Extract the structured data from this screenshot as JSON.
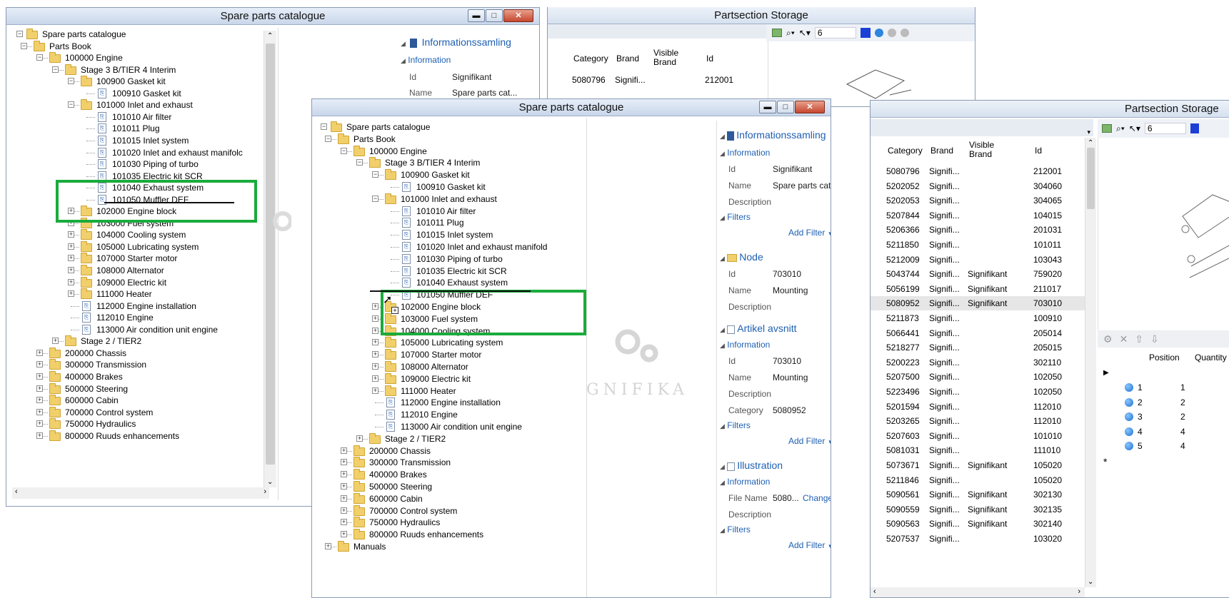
{
  "back_window": {
    "title": "Spare parts catalogue",
    "tree": [
      {
        "label": "Spare parts catalogue",
        "level": 0,
        "kind": "root"
      },
      {
        "label": "Parts Book",
        "level": 1,
        "kind": "folder"
      },
      {
        "label": "100000 Engine",
        "level": 2,
        "kind": "folder"
      },
      {
        "label": "Stage 3 B/TIER 4 Interim",
        "level": 3,
        "kind": "folder"
      },
      {
        "label": "100900 Gasket kit",
        "level": 4,
        "kind": "folder"
      },
      {
        "label": "100910 Gasket kit",
        "level": 5,
        "kind": "doc"
      },
      {
        "label": "101000 Inlet and exhaust",
        "level": 4,
        "kind": "folder"
      },
      {
        "label": "101010 Air filter",
        "level": 5,
        "kind": "doc"
      },
      {
        "label": "101011 Plug",
        "level": 5,
        "kind": "doc"
      },
      {
        "label": "101015 Inlet system",
        "level": 5,
        "kind": "doc"
      },
      {
        "label": "101020 Inlet and exhaust manifolc",
        "level": 5,
        "kind": "doc"
      },
      {
        "label": "101030 Piping of turbo",
        "level": 5,
        "kind": "doc"
      },
      {
        "label": "101035 Electric kit SCR",
        "level": 5,
        "kind": "doc"
      },
      {
        "label": "101040 Exhaust system",
        "level": 5,
        "kind": "doc"
      },
      {
        "label": "101050 Muffler DEF",
        "level": 5,
        "kind": "doc"
      },
      {
        "label": "102000 Engine block",
        "level": 4,
        "kind": "folder"
      },
      {
        "label": "103000 Fuel system",
        "level": 4,
        "kind": "folder"
      },
      {
        "label": "104000 Cooling system",
        "level": 4,
        "kind": "folder"
      },
      {
        "label": "105000 Lubricating system",
        "level": 4,
        "kind": "folder"
      },
      {
        "label": "107000 Starter motor",
        "level": 4,
        "kind": "folder"
      },
      {
        "label": "108000 Alternator",
        "level": 4,
        "kind": "folder"
      },
      {
        "label": "109000 Electric kit",
        "level": 4,
        "kind": "folder"
      },
      {
        "label": "111000 Heater",
        "level": 4,
        "kind": "folder"
      },
      {
        "label": "112000 Engine installation",
        "level": 4,
        "kind": "doc"
      },
      {
        "label": "112010 Engine",
        "level": 4,
        "kind": "doc"
      },
      {
        "label": "113000 Air condition unit engine",
        "level": 4,
        "kind": "doc"
      },
      {
        "label": "Stage 2 / TIER2",
        "level": 3,
        "kind": "folder"
      },
      {
        "label": "200000 Chassis",
        "level": 2,
        "kind": "folder"
      },
      {
        "label": "300000 Transmission",
        "level": 2,
        "kind": "folder"
      },
      {
        "label": "400000 Brakes",
        "level": 2,
        "kind": "folder"
      },
      {
        "label": "500000 Steering",
        "level": 2,
        "kind": "folder"
      },
      {
        "label": "600000 Cabin",
        "level": 2,
        "kind": "folder"
      },
      {
        "label": "700000 Control system",
        "level": 2,
        "kind": "folder"
      },
      {
        "label": "750000 Hydraulics",
        "level": 2,
        "kind": "folder"
      },
      {
        "label": "800000 Ruuds enhancements",
        "level": 2,
        "kind": "folder"
      }
    ],
    "panel": {
      "section": "Informationssamling",
      "sub": "Information",
      "rows": [
        {
          "k": "Id",
          "v": "Signifikant"
        },
        {
          "k": "Name",
          "v": "Spare parts cat..."
        }
      ]
    }
  },
  "back_storage": {
    "title": "Partsection Storage",
    "zoom_value": "6",
    "columns": [
      "Category",
      "Brand",
      "Visible Brand",
      "Id"
    ],
    "rows": [
      [
        "5080796",
        "Signifi...",
        "",
        "212001"
      ]
    ]
  },
  "front_window": {
    "title": "Spare parts catalogue",
    "watermark": "GNIFIKA",
    "tree": [
      {
        "label": "Spare parts catalogue",
        "level": 0,
        "kind": "root"
      },
      {
        "label": "Parts Book",
        "level": 1,
        "kind": "folder"
      },
      {
        "label": "100000 Engine",
        "level": 2,
        "kind": "folder"
      },
      {
        "label": "Stage 3 B/TIER 4 Interim",
        "level": 3,
        "kind": "folder"
      },
      {
        "label": "100900 Gasket kit",
        "level": 4,
        "kind": "folder"
      },
      {
        "label": "100910 Gasket kit",
        "level": 5,
        "kind": "doc"
      },
      {
        "label": "101000 Inlet and exhaust",
        "level": 4,
        "kind": "folder"
      },
      {
        "label": "101010 Air filter",
        "level": 5,
        "kind": "doc"
      },
      {
        "label": "101011 Plug",
        "level": 5,
        "kind": "doc"
      },
      {
        "label": "101015 Inlet system",
        "level": 5,
        "kind": "doc"
      },
      {
        "label": "101020 Inlet and exhaust manifold",
        "level": 5,
        "kind": "doc"
      },
      {
        "label": "101030 Piping of turbo",
        "level": 5,
        "kind": "doc"
      },
      {
        "label": "101035 Electric kit SCR",
        "level": 5,
        "kind": "doc"
      },
      {
        "label": "101040 Exhaust system",
        "level": 5,
        "kind": "doc"
      },
      {
        "label": "101050 Muffler DEF",
        "level": 5,
        "kind": "doc"
      },
      {
        "label": "102000 Engine block",
        "level": 4,
        "kind": "folder"
      },
      {
        "label": "103000 Fuel system",
        "level": 4,
        "kind": "folder"
      },
      {
        "label": "104000 Cooling system",
        "level": 4,
        "kind": "folder"
      },
      {
        "label": "105000 Lubricating system",
        "level": 4,
        "kind": "folder"
      },
      {
        "label": "107000 Starter motor",
        "level": 4,
        "kind": "folder"
      },
      {
        "label": "108000 Alternator",
        "level": 4,
        "kind": "folder"
      },
      {
        "label": "109000 Electric kit",
        "level": 4,
        "kind": "folder"
      },
      {
        "label": "111000 Heater",
        "level": 4,
        "kind": "folder"
      },
      {
        "label": "112000 Engine installation",
        "level": 4,
        "kind": "doc"
      },
      {
        "label": "112010 Engine",
        "level": 4,
        "kind": "doc"
      },
      {
        "label": "113000 Air condition unit engine",
        "level": 4,
        "kind": "doc"
      },
      {
        "label": "Stage 2 / TIER2",
        "level": 3,
        "kind": "folder"
      },
      {
        "label": "200000 Chassis",
        "level": 2,
        "kind": "folder"
      },
      {
        "label": "300000 Transmission",
        "level": 2,
        "kind": "folder"
      },
      {
        "label": "400000 Brakes",
        "level": 2,
        "kind": "folder"
      },
      {
        "label": "500000 Steering",
        "level": 2,
        "kind": "folder"
      },
      {
        "label": "600000 Cabin",
        "level": 2,
        "kind": "folder"
      },
      {
        "label": "700000 Control system",
        "level": 2,
        "kind": "folder"
      },
      {
        "label": "750000 Hydraulics",
        "level": 2,
        "kind": "folder"
      },
      {
        "label": "800000 Ruuds enhancements",
        "level": 2,
        "kind": "folder"
      },
      {
        "label": "Manuals",
        "level": 1,
        "kind": "folder"
      }
    ],
    "panel": {
      "informationssamling": "Informationssamling",
      "information": "Information",
      "id_label": "Id",
      "id_value": "Signifikant",
      "name_label": "Name",
      "name_value": "Spare parts cat...",
      "description_label": "Description",
      "filters": "Filters",
      "add_filter": "Add Filter",
      "node": "Node",
      "node_id": "703010",
      "node_name": "Mounting",
      "artikel": "Artikel avsnitt",
      "artikel_id": "703010",
      "artikel_name": "Mounting",
      "category_label": "Category",
      "category_value": "5080952",
      "illustration": "Illustration",
      "file_name_label": "File Name",
      "file_name_value": "5080...",
      "change": "Change"
    }
  },
  "front_storage": {
    "title": "Partsection Storage",
    "zoom_value": "6",
    "columns": [
      "Category",
      "Brand",
      "Visible Brand",
      "Id"
    ],
    "rows": [
      [
        "5080796",
        "Signifi...",
        "",
        "212001"
      ],
      [
        "5202052",
        "Signifi...",
        "",
        "304060"
      ],
      [
        "5202053",
        "Signifi...",
        "",
        "304065"
      ],
      [
        "5207844",
        "Signifi...",
        "",
        "104015"
      ],
      [
        "5206366",
        "Signifi...",
        "",
        "201031"
      ],
      [
        "5211850",
        "Signifi...",
        "",
        "101011"
      ],
      [
        "5212009",
        "Signifi...",
        "",
        "103043"
      ],
      [
        "5043744",
        "Signifi...",
        "Signifikant",
        "759020"
      ],
      [
        "5056199",
        "Signifi...",
        "Signifikant",
        "211017"
      ],
      [
        "5080952",
        "Signifi...",
        "Signifikant",
        "703010"
      ],
      [
        "5211873",
        "Signifi...",
        "",
        "100910"
      ],
      [
        "5066441",
        "Signifi...",
        "",
        "205014"
      ],
      [
        "5218277",
        "Signifi...",
        "",
        "205015"
      ],
      [
        "5200223",
        "Signifi...",
        "",
        "302110"
      ],
      [
        "5207500",
        "Signifi...",
        "",
        "102050"
      ],
      [
        "5223496",
        "Signifi...",
        "",
        "102050"
      ],
      [
        "5201594",
        "Signifi...",
        "",
        "112010"
      ],
      [
        "5203265",
        "Signifi...",
        "",
        "112010"
      ],
      [
        "5207603",
        "Signifi...",
        "",
        "101010"
      ],
      [
        "5081031",
        "Signifi...",
        "",
        "111010"
      ],
      [
        "5073671",
        "Signifi...",
        "Signifikant",
        "105020"
      ],
      [
        "5211846",
        "Signifi...",
        "",
        "105020"
      ],
      [
        "5090561",
        "Signifi...",
        "Signifikant",
        "302130"
      ],
      [
        "5090559",
        "Signifi...",
        "Signifikant",
        "302135"
      ],
      [
        "5090563",
        "Signifi...",
        "Signifikant",
        "302140"
      ],
      [
        "5207537",
        "Signifi...",
        "",
        "103020"
      ]
    ],
    "selected_row": 9,
    "pos_columns": [
      "Position",
      "Quantity"
    ],
    "pos_rows": [
      [
        "1",
        "1"
      ],
      [
        "2",
        "2"
      ],
      [
        "3",
        "2"
      ],
      [
        "4",
        "4"
      ],
      [
        "5",
        "4"
      ]
    ]
  }
}
